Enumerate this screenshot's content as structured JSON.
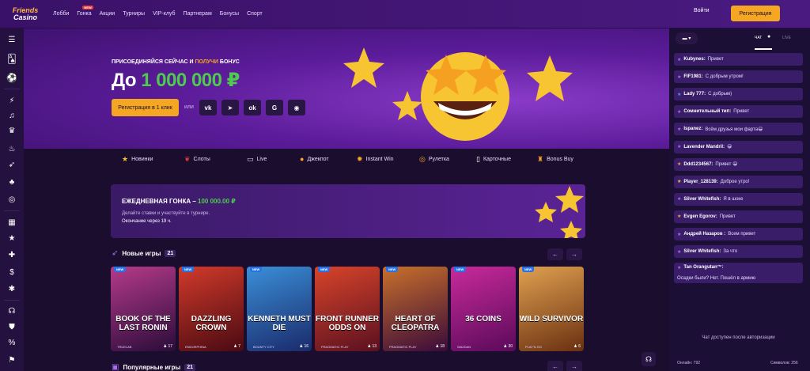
{
  "brand": {
    "line1": "Friends",
    "line2": "Casino"
  },
  "nav": [
    {
      "label": "Лобби"
    },
    {
      "label": "Гонка",
      "badge": "NEW"
    },
    {
      "label": "Акции"
    },
    {
      "label": "Турниры"
    },
    {
      "label": "VIP-клуб"
    },
    {
      "label": "Партнерам"
    },
    {
      "label": "Бонусы"
    },
    {
      "label": "Спорт"
    }
  ],
  "auth": {
    "login": "Войти",
    "register": "Регистрация"
  },
  "hero": {
    "sub_pre": "ПРИСОЕДИНЯЙСЯ СЕЙЧАС И ",
    "sub_hl": "ПОЛУЧИ",
    "sub_post": " БОНУС",
    "title_pre": "До ",
    "title_amount": "1 000 000 ₽",
    "cta": "Регистрация в 1 клик",
    "or": "или",
    "socials": [
      "VK",
      "Telegram",
      "OK",
      "G",
      "Steam"
    ]
  },
  "categories": [
    {
      "label": "Новинки",
      "icon": "star-icon"
    },
    {
      "label": "Слоты",
      "icon": "cherry-icon"
    },
    {
      "label": "Live",
      "icon": "live-icon"
    },
    {
      "label": "Джекпот",
      "icon": "coins-icon"
    },
    {
      "label": "Instant Win",
      "icon": "rocket-icon"
    },
    {
      "label": "Рулетка",
      "icon": "roulette-icon"
    },
    {
      "label": "Карточные",
      "icon": "cards-icon"
    },
    {
      "label": "Bonus Buy",
      "icon": "bonus-icon"
    }
  ],
  "race": {
    "title": "ЕЖЕДНЕВНАЯ ГОНКА – ",
    "amount": "100 000.00 ₽",
    "text": "Делайте ставки и участвуйте в турнире.",
    "ends": "Окончание через 19 ч."
  },
  "new_games": {
    "title": "Новые игры",
    "count": "21"
  },
  "popular_games": {
    "title": "Популярные игры",
    "count": "21"
  },
  "games": [
    {
      "title": "BOOK OF THE LAST RONIN",
      "provider": "TRUELAB",
      "players": "17",
      "badge": "NEW",
      "color1": "#b53a8a",
      "color2": "#2a0c3a"
    },
    {
      "title": "DAZZLING CROWN",
      "provider": "ENDORPHINA",
      "players": "7",
      "badge": "NEW",
      "color1": "#d13a2a",
      "color2": "#4a0a12"
    },
    {
      "title": "KENNETH MUST DIE",
      "provider": "BOUNTY CITY",
      "players": "16",
      "badge": "NEW",
      "color1": "#3a8fd8",
      "color2": "#1a2a6a"
    },
    {
      "title": "FRONT RUNNER ODDS ON",
      "provider": "PRAGMATIC PLAY",
      "players": "13",
      "badge": "NEW",
      "color1": "#d8442a",
      "color2": "#5a1020"
    },
    {
      "title": "HEART OF CLEOPATRA",
      "provider": "PRAGMATIC PLAY",
      "players": "18",
      "badge": "NEW",
      "color1": "#c8702a",
      "color2": "#3a0a3a"
    },
    {
      "title": "36 COINS",
      "provider": "WAZDAN",
      "players": "30",
      "badge": "NEW",
      "color1": "#c82a9a",
      "color2": "#5a0a5a"
    },
    {
      "title": "WILD SURVIVOR",
      "provider": "PLAY'N GO",
      "players": "6",
      "badge": "NEW",
      "color1": "#e0a050",
      "color2": "#6a3010"
    }
  ],
  "chat": {
    "tab_chat": "ЧАТ",
    "tab_live": "LIVE",
    "messages": [
      {
        "name": "Kubynes:",
        "text": "Привет",
        "star": "#a86cf0"
      },
      {
        "name": "FIF1981:",
        "text": "С добрым утром!",
        "star": "#a86cf0"
      },
      {
        "name": "Lady 777:",
        "text": "С добрым)",
        "star": "#5a8ff0"
      },
      {
        "name": "Сомнительный тип:",
        "text": "Привет",
        "star": "#a86cf0"
      },
      {
        "name": "Ispanez:",
        "text": "Всём друзья мои фарта😀",
        "star": "#a86cf0"
      },
      {
        "name": "Lavender Mandril:",
        "text": "😀",
        "star": "#a86cf0"
      },
      {
        "name": "Ddd1234567:",
        "text": "Привет 😀",
        "star": "#f0a040"
      },
      {
        "name": "Player_128139:",
        "text": "Доброе утро!",
        "star": "#f0c040"
      },
      {
        "name": "Silver Whitefish:",
        "text": "Я в шоке",
        "star": "#a86cf0"
      },
      {
        "name": "Evgen Egorov:",
        "text": "Привет",
        "star": "#f0a040"
      },
      {
        "name": "Андрей Назаров :",
        "text": "Всем привет",
        "star": "#a86cf0"
      },
      {
        "name": "Silver Whitefish:",
        "text": "За что",
        "star": "#a86cf0"
      },
      {
        "name": "Tan Orangutan™:",
        "text": "Осадки были? Нет. Пошёл в армию",
        "star": "#a86cf0"
      }
    ],
    "auth_note": "Чат доступен после авторизации",
    "online": "Онлайн: 792",
    "symbols": "Символов: 256"
  },
  "colors": {
    "accent": "#f5a623",
    "green": "#4ecb4e",
    "bg": "#1a0d2e",
    "purple": "#5a1b98"
  }
}
